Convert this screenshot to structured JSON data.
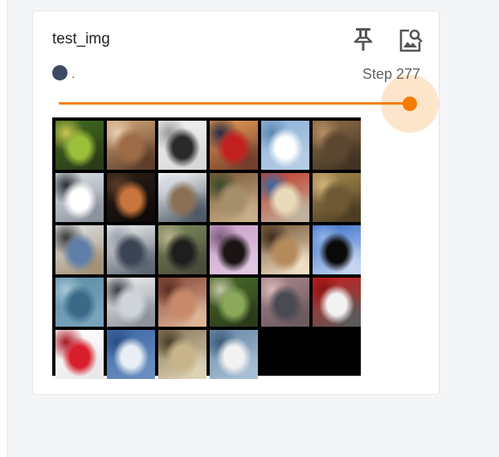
{
  "card": {
    "title": "test_img",
    "run_name": ".",
    "step_label": "Step 277"
  },
  "colors": {
    "accent": "#f57c00",
    "run_dot": "#3d4a63",
    "panel_bg": "#f4f5f7"
  },
  "icons": {
    "pin": "pin-icon",
    "view": "image-search-icon"
  },
  "slider": {
    "level": 1.0
  },
  "image_grid": {
    "columns": 6,
    "rows": 5,
    "tiles": [
      {
        "subject": "frog",
        "colors": [
          "#3e6b1f",
          "#9bbf3a",
          "#c9c64e",
          "#2a3a18"
        ]
      },
      {
        "subject": "girl with dog",
        "colors": [
          "#d5a77a",
          "#9e6b47",
          "#e8cfb2",
          "#5a3b29"
        ]
      },
      {
        "subject": "cat",
        "colors": [
          "#f2f2f2",
          "#2a2a2a",
          "#9a9a9a",
          "#d8d8d8"
        ]
      },
      {
        "subject": "red car at sunset",
        "colors": [
          "#e79b56",
          "#c32020",
          "#2a2a44",
          "#6f3d2c"
        ]
      },
      {
        "subject": "sailboat",
        "colors": [
          "#8fb4dc",
          "#ffffff",
          "#5e88b1",
          "#b7cde4"
        ]
      },
      {
        "subject": "toad",
        "colors": [
          "#8d6b47",
          "#5b4630",
          "#b58d64",
          "#3f3323"
        ]
      },
      {
        "subject": "white car",
        "colors": [
          "#dfe4ea",
          "#ffffff",
          "#2a2e36",
          "#8a919b"
        ]
      },
      {
        "subject": "cat on couch",
        "colors": [
          "#2a1e18",
          "#c8753c",
          "#5e3b28",
          "#0e0a08"
        ]
      },
      {
        "subject": "ship",
        "colors": [
          "#ffffff",
          "#8a6f55",
          "#cfd6de",
          "#4a5563"
        ]
      },
      {
        "subject": "horse rider",
        "colors": [
          "#7d5a3a",
          "#a58f6b",
          "#3a4b2a",
          "#c9b08a"
        ]
      },
      {
        "subject": "truck",
        "colors": [
          "#c23b2a",
          "#e8d9b8",
          "#3b6aa3",
          "#bfb6a1"
        ]
      },
      {
        "subject": "frog",
        "colors": [
          "#a88b4e",
          "#6e5833",
          "#d1b47a",
          "#4a3b22"
        ]
      },
      {
        "subject": "boat",
        "colors": [
          "#dfe3e8",
          "#5f7fa8",
          "#3a3a3a",
          "#a38f73"
        ]
      },
      {
        "subject": "truck",
        "colors": [
          "#f2f2f2",
          "#3b4454",
          "#9aa3b0",
          "#5a6370"
        ]
      },
      {
        "subject": "dog",
        "colors": [
          "#7a8a5a",
          "#1e1e1e",
          "#b8b08c",
          "#4a4a3a"
        ]
      },
      {
        "subject": "dog",
        "colors": [
          "#c9a0c9",
          "#1a1414",
          "#7a5a7a",
          "#e2c8e2"
        ]
      },
      {
        "subject": "frog",
        "colors": [
          "#7a5a3a",
          "#b58a5a",
          "#3e2c1c",
          "#f2e2c8"
        ]
      },
      {
        "subject": "bird",
        "colors": [
          "#3a6ec8",
          "#0a0a0a",
          "#8fb2e8",
          "#c8d8f2"
        ]
      },
      {
        "subject": "ship",
        "colors": [
          "#5f8fa8",
          "#3a6a88",
          "#a8c8d8",
          "#7aa4bc"
        ]
      },
      {
        "subject": "white car",
        "colors": [
          "#f2f2f2",
          "#cfd4da",
          "#3a3e46",
          "#8a9098"
        ]
      },
      {
        "subject": "frog",
        "colors": [
          "#8a4a3a",
          "#c88a6a",
          "#5a2e22",
          "#e0b89a"
        ]
      },
      {
        "subject": "bird",
        "colors": [
          "#4a6a2a",
          "#8aa85a",
          "#c8c8a8",
          "#2a3a1a"
        ]
      },
      {
        "subject": "dog",
        "colors": [
          "#a8848a",
          "#4a4a52",
          "#d8b8b8",
          "#6a5a5e"
        ]
      },
      {
        "subject": "fire truck",
        "colors": [
          "#c81e1e",
          "#f2f2f2",
          "#8a1414",
          "#5a5a5a"
        ]
      },
      {
        "subject": "red car",
        "colors": [
          "#ffffff",
          "#d81e2a",
          "#a81420",
          "#e8e8e8"
        ]
      },
      {
        "subject": "airplane",
        "colors": [
          "#3e6aa8",
          "#e8eef4",
          "#2a4e84",
          "#6a8ec0"
        ]
      },
      {
        "subject": "airplane",
        "colors": [
          "#8a7a5a",
          "#c8b48a",
          "#4a3e2a",
          "#e0d4b8"
        ]
      },
      {
        "subject": "boat",
        "colors": [
          "#6a8aa8",
          "#f2f2f2",
          "#3a5a78",
          "#a8c0d4"
        ]
      }
    ]
  }
}
